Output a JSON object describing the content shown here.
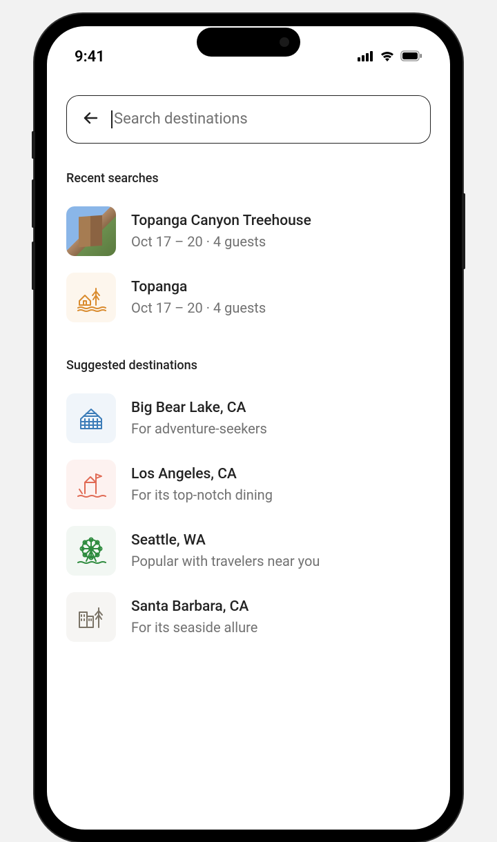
{
  "status_bar": {
    "time": "9:41"
  },
  "search": {
    "placeholder": "Search destinations"
  },
  "sections": {
    "recent": {
      "header": "Recent searches",
      "items": [
        {
          "title": "Topanga Canyon Treehouse",
          "sub": "Oct 17 – 20 · 4 guests",
          "thumb": "photo"
        },
        {
          "title": "Topanga",
          "sub": "Oct 17 – 20 · 4 guests",
          "thumb": "topanga"
        }
      ]
    },
    "suggested": {
      "header": "Suggested destinations",
      "items": [
        {
          "title": "Big Bear Lake, CA",
          "sub": "For adventure-seekers",
          "thumb": "bigbear"
        },
        {
          "title": "Los Angeles, CA",
          "sub": "For its top-notch dining",
          "thumb": "la"
        },
        {
          "title": "Seattle, WA",
          "sub": "Popular with travelers near you",
          "thumb": "seattle"
        },
        {
          "title": "Santa Barbara, CA",
          "sub": "For its seaside allure",
          "thumb": "sb"
        }
      ]
    }
  }
}
